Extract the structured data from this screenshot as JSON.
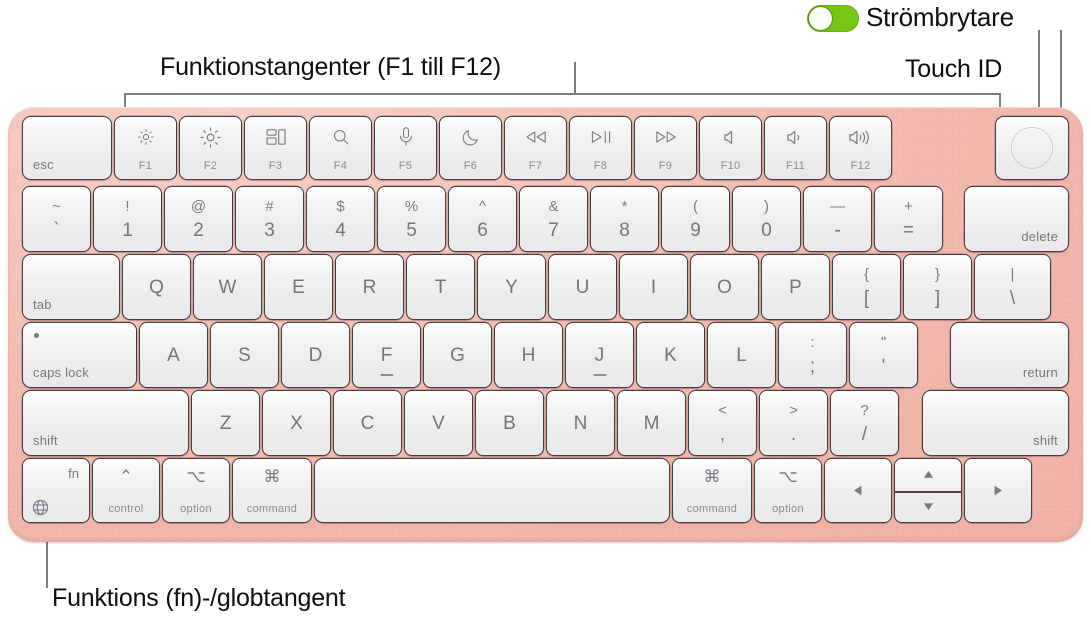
{
  "callouts": {
    "function_keys": "Funktionstangenter (F1 till F12)",
    "power_switch": "Strömbrytare",
    "touch_id": "Touch ID",
    "fn_globe": "Funktions (fn)-/globtangent"
  },
  "power_switch": {
    "state": "on",
    "color_on": "#76c511",
    "knob_color": "#fbfbfb"
  },
  "keyboard": {
    "body_color": "#f0b3a6",
    "key_face_color": "#eeeef0",
    "legend_color": "#74747a",
    "rows": {
      "function_row": [
        {
          "name": "esc",
          "label": "esc"
        },
        {
          "name": "f1",
          "fn": "F1",
          "icon": "brightness-down-icon"
        },
        {
          "name": "f2",
          "fn": "F2",
          "icon": "brightness-up-icon"
        },
        {
          "name": "f3",
          "fn": "F3",
          "icon": "mission-control-icon"
        },
        {
          "name": "f4",
          "fn": "F4",
          "icon": "spotlight-search-icon"
        },
        {
          "name": "f5",
          "fn": "F5",
          "icon": "dictation-mic-icon"
        },
        {
          "name": "f6",
          "fn": "F6",
          "icon": "do-not-disturb-moon-icon"
        },
        {
          "name": "f7",
          "fn": "F7",
          "icon": "rewind-icon"
        },
        {
          "name": "f8",
          "fn": "F8",
          "icon": "play-pause-icon"
        },
        {
          "name": "f9",
          "fn": "F9",
          "icon": "fast-forward-icon"
        },
        {
          "name": "f10",
          "fn": "F10",
          "icon": "volume-mute-icon"
        },
        {
          "name": "f11",
          "fn": "F11",
          "icon": "volume-down-icon"
        },
        {
          "name": "f12",
          "fn": "F12",
          "icon": "volume-up-icon"
        },
        {
          "name": "touch-id",
          "icon": "touch-id-icon"
        }
      ],
      "number_row": [
        {
          "top": "~",
          "bot": "`"
        },
        {
          "top": "!",
          "bot": "1"
        },
        {
          "top": "@",
          "bot": "2"
        },
        {
          "top": "#",
          "bot": "3"
        },
        {
          "top": "$",
          "bot": "4"
        },
        {
          "top": "%",
          "bot": "5"
        },
        {
          "top": "^",
          "bot": "6"
        },
        {
          "top": "&",
          "bot": "7"
        },
        {
          "top": "*",
          "bot": "8"
        },
        {
          "top": "(",
          "bot": "9"
        },
        {
          "top": ")",
          "bot": "0"
        },
        {
          "top": "—",
          "bot": "-"
        },
        {
          "top": "+",
          "bot": "="
        },
        {
          "label": "delete"
        }
      ],
      "top_row": [
        {
          "label": "tab"
        },
        {
          "glyph": "Q"
        },
        {
          "glyph": "W"
        },
        {
          "glyph": "E"
        },
        {
          "glyph": "R"
        },
        {
          "glyph": "T"
        },
        {
          "glyph": "Y"
        },
        {
          "glyph": "U"
        },
        {
          "glyph": "I"
        },
        {
          "glyph": "O"
        },
        {
          "glyph": "P"
        },
        {
          "top": "{",
          "bot": "["
        },
        {
          "top": "}",
          "bot": "]"
        },
        {
          "top": "|",
          "bot": "\\"
        }
      ],
      "home_row": [
        {
          "label": "caps lock"
        },
        {
          "glyph": "A"
        },
        {
          "glyph": "S"
        },
        {
          "glyph": "D"
        },
        {
          "glyph": "F",
          "bump": true
        },
        {
          "glyph": "G"
        },
        {
          "glyph": "H"
        },
        {
          "glyph": "J",
          "bump": true
        },
        {
          "glyph": "K"
        },
        {
          "glyph": "L"
        },
        {
          "top": ":",
          "bot": ";"
        },
        {
          "top": "\"",
          "bot": "'"
        },
        {
          "label": "return"
        }
      ],
      "shift_row": [
        {
          "label": "shift"
        },
        {
          "glyph": "Z"
        },
        {
          "glyph": "X"
        },
        {
          "glyph": "C"
        },
        {
          "glyph": "V"
        },
        {
          "glyph": "B"
        },
        {
          "glyph": "N"
        },
        {
          "glyph": "M"
        },
        {
          "top": "<",
          "bot": ","
        },
        {
          "top": ">",
          "bot": "."
        },
        {
          "top": "?",
          "bot": "/"
        },
        {
          "label": "shift"
        }
      ],
      "bottom_row": [
        {
          "name": "fn-globe",
          "label": "fn",
          "icon": "globe-icon"
        },
        {
          "name": "control-left",
          "label": "control",
          "symbol": "⌃"
        },
        {
          "name": "option-left",
          "label": "option",
          "symbol": "⌥"
        },
        {
          "name": "command-left",
          "label": "command",
          "symbol": "⌘"
        },
        {
          "name": "space",
          "label": ""
        },
        {
          "name": "command-right",
          "label": "command",
          "symbol": "⌘"
        },
        {
          "name": "option-right",
          "label": "option",
          "symbol": "⌥"
        },
        {
          "name": "arrow-left",
          "icon": "arrow-left-icon"
        },
        {
          "name": "arrow-up",
          "icon": "arrow-up-icon"
        },
        {
          "name": "arrow-down",
          "icon": "arrow-down-icon"
        },
        {
          "name": "arrow-right",
          "icon": "arrow-right-icon"
        }
      ]
    }
  }
}
